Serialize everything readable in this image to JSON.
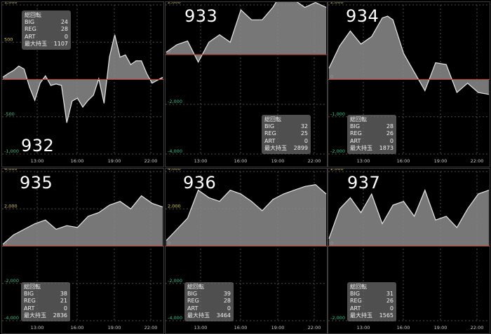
{
  "colors": {
    "background": "#000000",
    "grid": "#4a4a4a",
    "zero_line": "#c0392b",
    "positive_tick": "#d9c85a",
    "negative_tick": "#39c08a",
    "area_fill": "#8c8c8c",
    "line": "#e8e8e8"
  },
  "x_ticks": [
    "13:00",
    "16:00",
    "19:00",
    "22:00"
  ],
  "stat_labels": {
    "title": "総回転",
    "big": "BIG",
    "reg": "REG",
    "art": "ART",
    "max": "最大持玉"
  },
  "panels": [
    {
      "machine": "932",
      "stats": {
        "big": "24",
        "reg": "28",
        "art": "0",
        "max": "1107"
      },
      "chart_data": {
        "type": "area",
        "ylim": [
          -1000,
          1000
        ],
        "y_ticks": [
          "1,000",
          "500",
          "0",
          "-500",
          "-1,000"
        ],
        "x": [
          0.0,
          0.5,
          1.0,
          1.5,
          2.0,
          2.5,
          3.0,
          3.5,
          4.0,
          4.5,
          5.0,
          5.5,
          6.0,
          6.5,
          7.0,
          7.5,
          8.0,
          8.5,
          9.0,
          9.5,
          10.0,
          10.5,
          11.0,
          11.5,
          12.0,
          12.5,
          13.0,
          13.5,
          14.0,
          14.5,
          15.0
        ],
        "values": [
          30,
          80,
          120,
          180,
          140,
          -100,
          -280,
          -50,
          50,
          -80,
          -60,
          -80,
          -580,
          -290,
          -250,
          -370,
          -280,
          -210,
          10,
          -320,
          300,
          600,
          300,
          330,
          200,
          250,
          250,
          80,
          -50,
          -10,
          30
        ]
      }
    },
    {
      "machine": "933",
      "stats": {
        "big": "32",
        "reg": "25",
        "art": "0",
        "max": "2899"
      },
      "chart_data": {
        "type": "area",
        "ylim": [
          -4000,
          2000
        ],
        "y_ticks": [
          "2,000",
          "0",
          "-2,000",
          "-4,000"
        ],
        "x": [
          0.0,
          1.0,
          2.0,
          3.0,
          4.0,
          5.0,
          6.0,
          7.0,
          8.0,
          9.0,
          10.0,
          11.0,
          12.0,
          13.0,
          14.0,
          15.0
        ],
        "values": [
          100,
          400,
          550,
          -300,
          500,
          800,
          500,
          1800,
          1400,
          1400,
          1900,
          2600,
          2200,
          1900,
          2100,
          1900
        ]
      }
    },
    {
      "machine": "934",
      "stats": {
        "big": "28",
        "reg": "26",
        "art": "0",
        "max": "1873"
      },
      "chart_data": {
        "type": "area",
        "ylim": [
          -2000,
          2000
        ],
        "y_ticks": [
          "2,000",
          "0",
          "-1,000",
          "-2,000"
        ],
        "x": [
          0.0,
          1.0,
          2.0,
          3.0,
          4.0,
          5.0,
          5.5,
          6.0,
          7.0,
          8.0,
          9.0,
          10.0,
          11.0,
          12.0,
          13.0,
          14.0,
          15.0
        ],
        "values": [
          300,
          900,
          1300,
          950,
          1150,
          1650,
          1700,
          1600,
          700,
          200,
          -300,
          450,
          400,
          -350,
          -100,
          -350,
          -400
        ]
      }
    },
    {
      "machine": "935",
      "stats": {
        "big": "38",
        "reg": "21",
        "art": "0",
        "max": "2836"
      },
      "chart_data": {
        "type": "area",
        "ylim": [
          -4000,
          4000
        ],
        "y_ticks": [
          "4,000",
          "2,000",
          "0",
          "-2,000",
          "-4,000"
        ],
        "x": [
          0.0,
          1.0,
          2.0,
          3.0,
          4.0,
          5.0,
          6.0,
          7.0,
          8.0,
          9.0,
          10.0,
          11.0,
          12.0,
          13.0,
          14.0,
          15.0
        ],
        "values": [
          100,
          600,
          900,
          1200,
          1400,
          900,
          1100,
          1000,
          1600,
          1800,
          2200,
          2400,
          2000,
          2700,
          2300,
          2100
        ]
      }
    },
    {
      "machine": "936",
      "stats": {
        "big": "39",
        "reg": "28",
        "art": "0",
        "max": "3464"
      },
      "chart_data": {
        "type": "area",
        "ylim": [
          -4000,
          4000
        ],
        "y_ticks": [
          "4,000",
          "2,000",
          "0",
          "-2,000",
          "-4,000"
        ],
        "x": [
          0.0,
          1.0,
          2.0,
          3.0,
          4.0,
          5.0,
          6.0,
          7.0,
          8.0,
          9.0,
          10.0,
          11.0,
          12.0,
          13.0,
          14.0,
          15.0
        ],
        "values": [
          300,
          900,
          1500,
          3000,
          2600,
          2400,
          3000,
          2800,
          2400,
          1900,
          2500,
          2800,
          3000,
          3200,
          3300,
          2800
        ]
      }
    },
    {
      "machine": "937",
      "stats": {
        "big": "31",
        "reg": "26",
        "art": "0",
        "max": "1565"
      },
      "chart_data": {
        "type": "area",
        "ylim": [
          -2000,
          2000
        ],
        "y_ticks": [
          "2,000",
          "0",
          "-2,000"
        ],
        "x": [
          0.0,
          1.0,
          2.0,
          3.0,
          4.0,
          5.0,
          6.0,
          7.0,
          8.0,
          9.0,
          10.0,
          11.0,
          12.0,
          13.0,
          14.0,
          15.0
        ],
        "values": [
          200,
          1000,
          1300,
          900,
          1400,
          600,
          1100,
          1200,
          800,
          1500,
          700,
          800,
          500,
          1000,
          1400,
          1500
        ]
      }
    }
  ]
}
